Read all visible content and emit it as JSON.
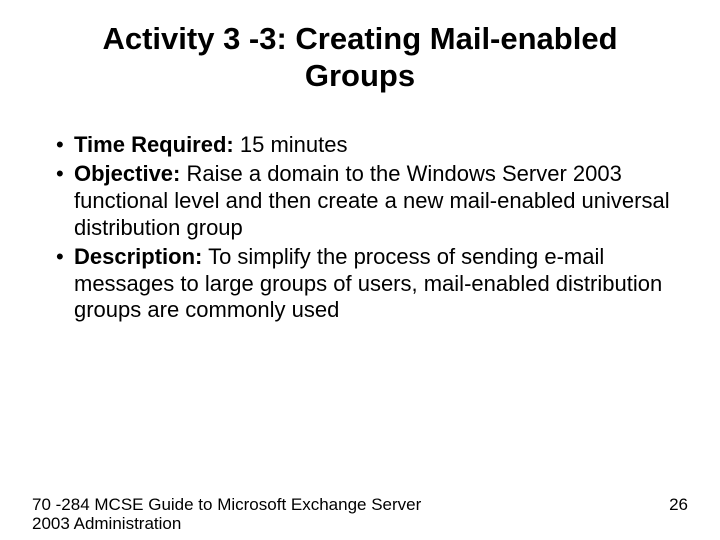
{
  "title": "Activity 3 -3: Creating Mail-enabled Groups",
  "bullets": [
    {
      "label": "Time Required:",
      "text": " 15 minutes"
    },
    {
      "label": "Objective:",
      "text": " Raise a domain to the Windows Server 2003 functional level and then create a new mail-enabled universal distribution group"
    },
    {
      "label": "Description:",
      "text": " To simplify the process of sending e-mail messages to large groups of users, mail-enabled distribution groups are commonly used"
    }
  ],
  "footer": {
    "left": "70 -284 MCSE Guide to Microsoft Exchange Server 2003 Administration",
    "page": "26"
  }
}
